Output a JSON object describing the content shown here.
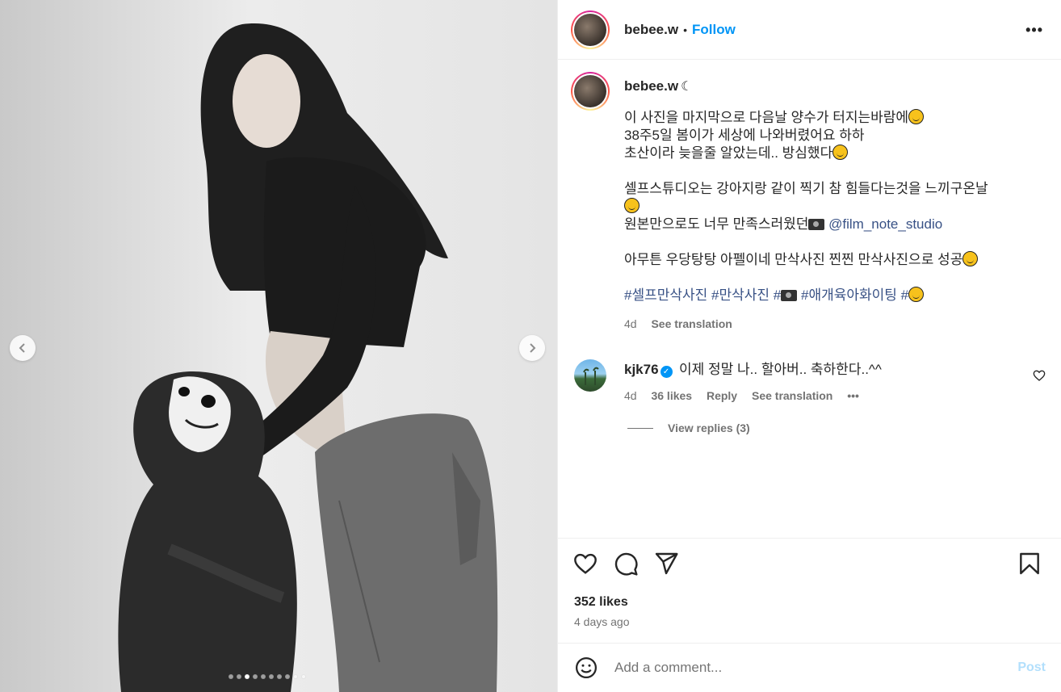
{
  "header": {
    "username": "bebee.w",
    "bullet": "•",
    "follow_label": "Follow",
    "more_label": "•••"
  },
  "caption": {
    "username": "bebee.w",
    "moon": "☾",
    "line1": "이 사진을 마지막으로 다음날 양수가 터지는바람에",
    "line2": "38주5일 봄이가 세상에 나와버렸어요 하하",
    "line3": "초산이라 늦을줄 알았는데.. 방심했다",
    "line4": "셀프스튜디오는 강아지랑 같이 찍기 참 힘들다는것을 느끼구온날",
    "line5": "원본만으로도 너무 만족스러웠던",
    "mention": "@film_note_studio",
    "line6": "아무튼 우당탕탕 아펠이네 만삭사진 찐찐 만삭사진으로 성공",
    "tag1": "#셀프만삭사진",
    "tag2": "#만삭사진",
    "tag3": "#",
    "tag4": "#애개육아화이팅",
    "tag5": "#",
    "age": "4d",
    "see_translation": "See translation"
  },
  "comment": {
    "username": "kjk76",
    "verified": "✓",
    "text": "이제 정말 나.. 할아버.. 축하한다..^^",
    "age": "4d",
    "likes": "36 likes",
    "reply": "Reply",
    "see_translation": "See translation",
    "more": "•••",
    "view_replies": "View replies (3)"
  },
  "footer": {
    "likes": "352 likes",
    "time": "4 days ago",
    "add_comment_placeholder": "Add a comment...",
    "post_label": "Post"
  },
  "carousel": {
    "total": 10,
    "active_index": 2
  },
  "colors": {
    "accent": "#0095f6",
    "link": "#385185",
    "muted": "#737373"
  }
}
